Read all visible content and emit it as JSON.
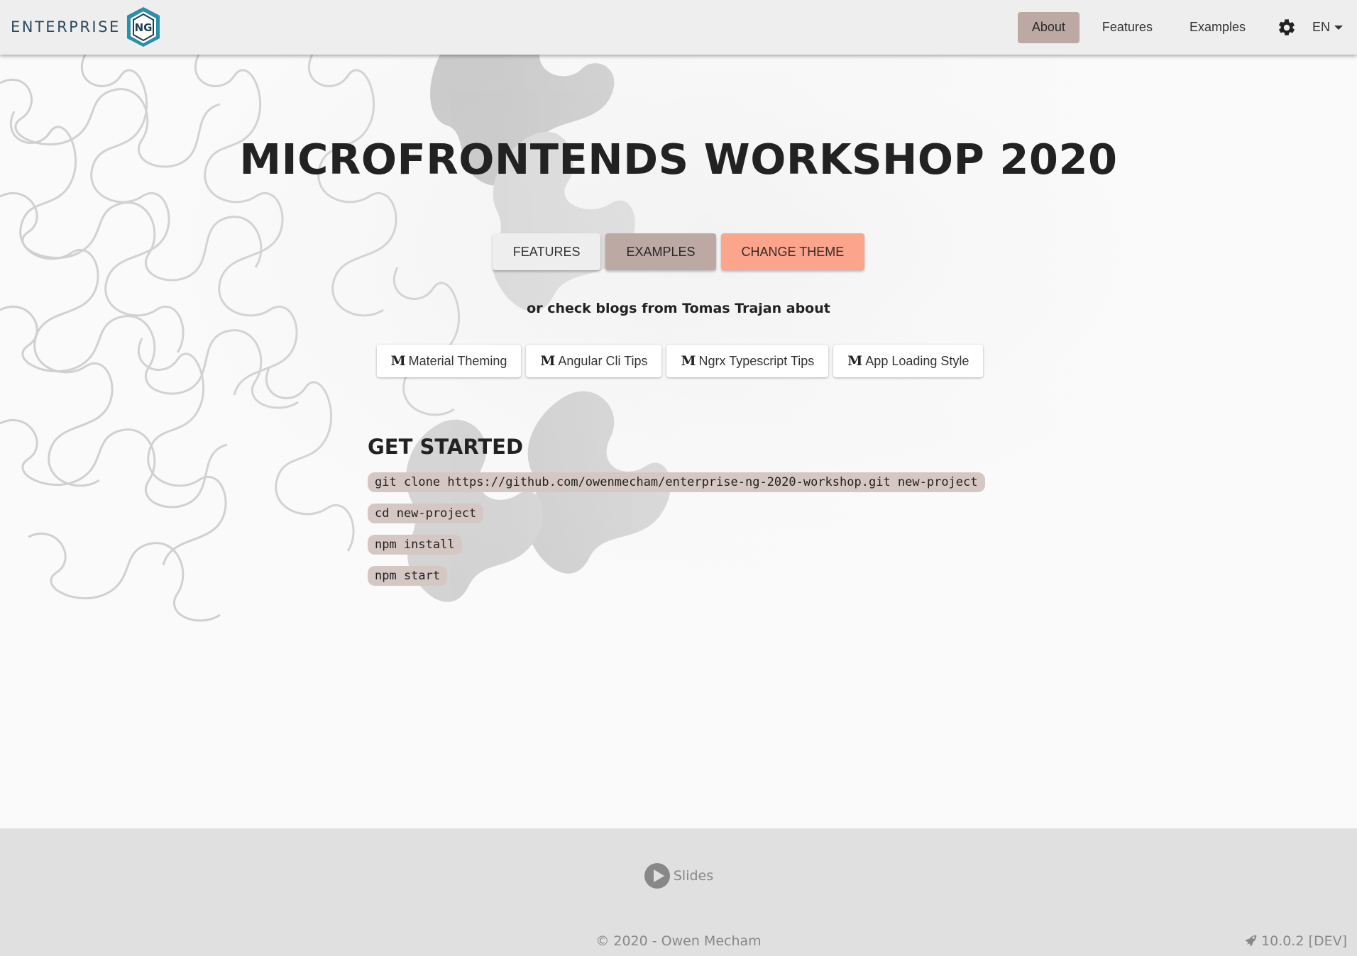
{
  "toolbar": {
    "brand_text": "ENTERPRISE",
    "brand_badge": "NG",
    "nav": [
      {
        "label": "About",
        "active": true
      },
      {
        "label": "Features",
        "active": false
      },
      {
        "label": "Examples",
        "active": false
      }
    ],
    "settings_icon": "gear-icon",
    "language": "EN"
  },
  "hero": {
    "title": "MICROFRONTENDS WORKSHOP 2020",
    "actions": [
      "FEATURES",
      "EXAMPLES",
      "CHANGE THEME"
    ],
    "blogs_intro": "or check blogs from Tomas Trajan about",
    "blogs": [
      {
        "icon": "M",
        "label": "Material Theming"
      },
      {
        "icon": "M",
        "label": "Angular Cli Tips"
      },
      {
        "icon": "M",
        "label": "Ngrx Typescript Tips"
      },
      {
        "icon": "M",
        "label": "App Loading Style"
      }
    ]
  },
  "get_started": {
    "heading": "GET STARTED",
    "commands": [
      "git clone https://github.com/owenmecham/enterprise-ng-2020-workshop.git new-project",
      "cd new-project",
      "npm install",
      "npm start"
    ]
  },
  "footer": {
    "slides_label": "Slides",
    "copyright": "© 2020 - Owen Mecham",
    "version": "10.0.2 [DEV]"
  },
  "colors": {
    "accent": "#bca9a4",
    "warn": "#fca48c",
    "toolbar_bg": "#eeeeee",
    "footer_bg": "#e0e0e0"
  }
}
